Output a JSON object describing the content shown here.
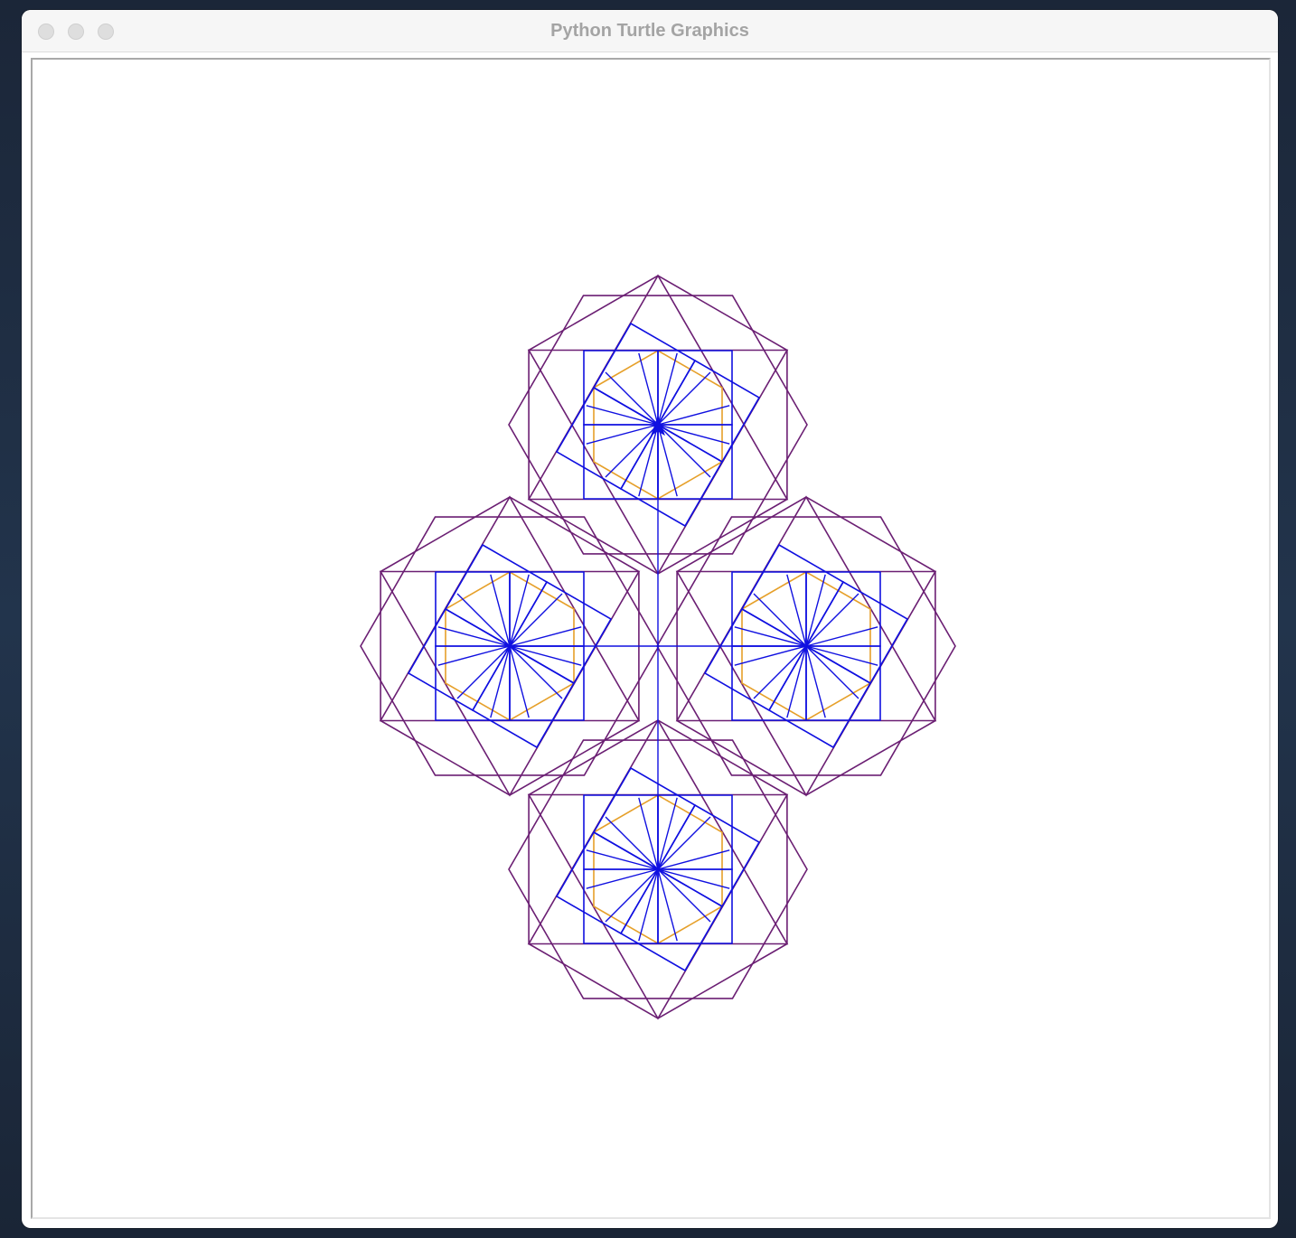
{
  "window": {
    "title": "Python Turtle Graphics"
  },
  "controls": {
    "close": "close-button",
    "minimize": "minimize-button",
    "maximize": "maximize-button"
  },
  "colors": {
    "hexagon": "#6b1f73",
    "square": "#1010e0",
    "inner_hexagon": "#e6a02a",
    "spokes": "#1010e0",
    "turtle": "#1010e0"
  },
  "turtle": {
    "shape": "classic",
    "heading_deg": 90
  },
  "pattern": {
    "motif_count": 4,
    "hexagons_per_motif": 2,
    "squares_per_motif": 4,
    "spokes_per_motif": 12
  }
}
